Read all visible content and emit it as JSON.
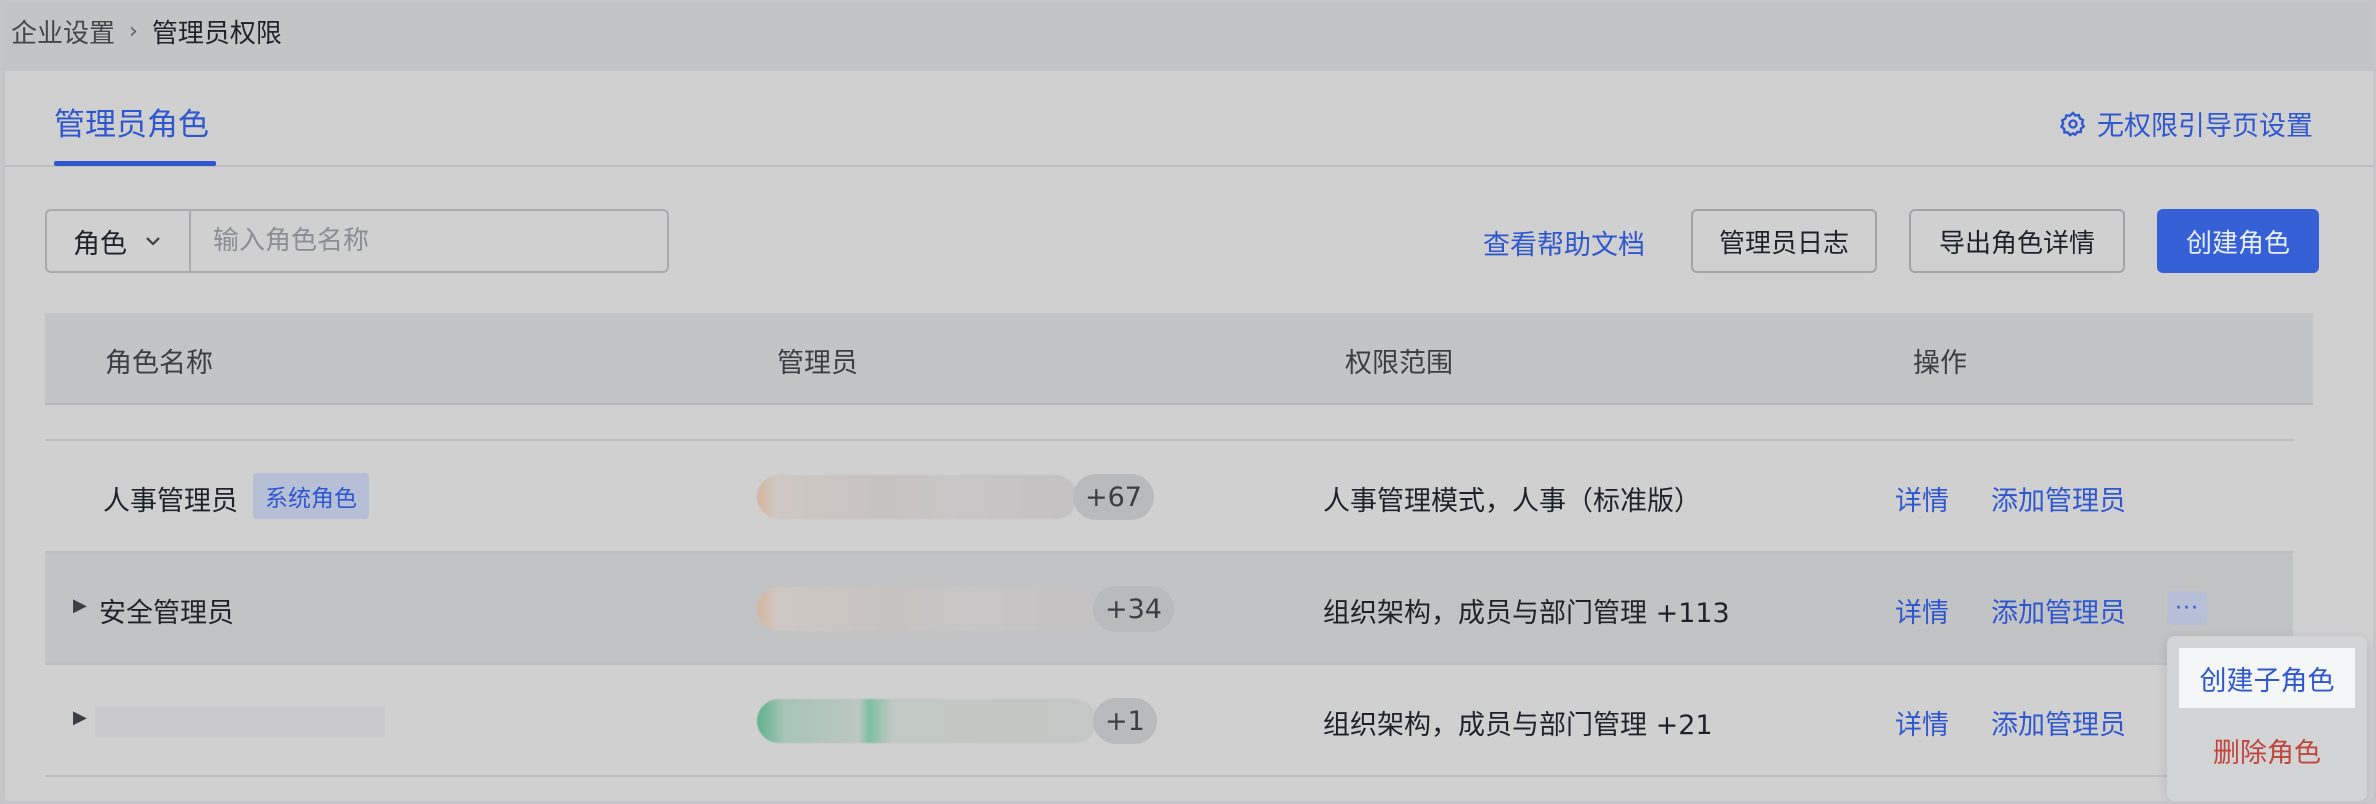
{
  "breadcrumb": {
    "parent": "企业设置",
    "current": "管理员权限"
  },
  "tabs": {
    "active": "管理员角色"
  },
  "guide_link": "无权限引导页设置",
  "toolbar": {
    "role_select": "角色",
    "search_placeholder": "输入角色名称",
    "help_link": "查看帮助文档",
    "admin_log_button": "管理员日志",
    "export_button": "导出角色详情",
    "create_button": "创建角色"
  },
  "table": {
    "headers": [
      "角色名称",
      "管理员",
      "权限范围",
      "操作"
    ],
    "rows": [
      {
        "name": "人事管理员",
        "tag": "系统角色",
        "admin_count": "+67",
        "scope": "人事管理模式，人事（标准版）",
        "detail": "详情",
        "add_admin": "添加管理员"
      },
      {
        "name": "安全管理员",
        "admin_count": "+34",
        "scope": "组织架构，成员与部门管理 +113",
        "detail": "详情",
        "add_admin": "添加管理员",
        "more": "···"
      },
      {
        "name": "",
        "admin_count": "+1",
        "scope": "组织架构，成员与部门管理 +21",
        "detail": "详情",
        "add_admin": "添加管理员"
      }
    ]
  },
  "dropdown": {
    "items": [
      "创建子角色",
      "删除角色"
    ]
  },
  "colors": {
    "accent": "#2f57d0",
    "danger": "#c0473d",
    "primary_button": "#3560d6"
  }
}
